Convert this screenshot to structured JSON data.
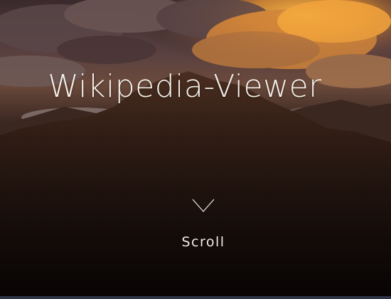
{
  "hero": {
    "title": "Wikipedia-Viewer",
    "scroll_label": "Scroll",
    "chevron_icon": "chevron-down-icon",
    "background_image": "sunset-mountain-clouds"
  },
  "colors": {
    "title_text": "#f4efe9",
    "cloud_highlight": "#f5a63a",
    "sky": "#4b3638",
    "mountain": "#1c110c",
    "bottom_edge": "#2f3445"
  }
}
